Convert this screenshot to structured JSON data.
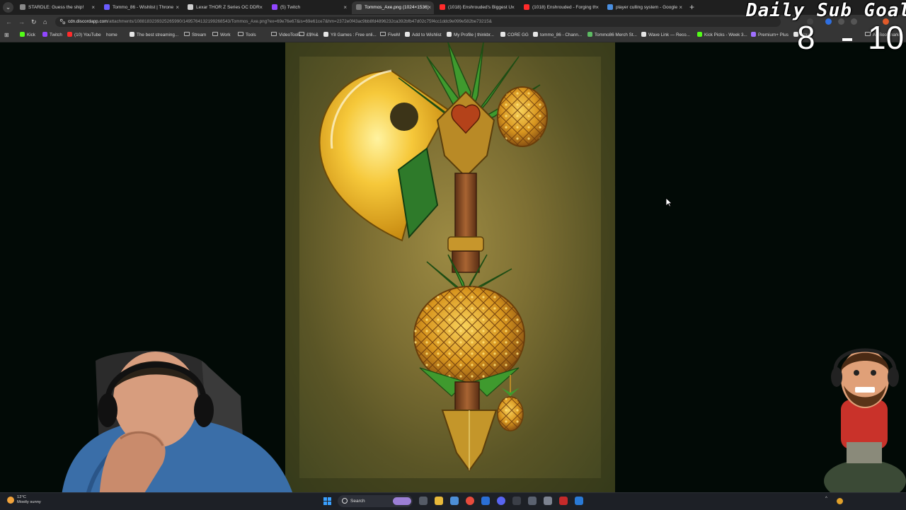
{
  "browser": {
    "tabs": [
      {
        "title": "STARDLE: Guess the ship!",
        "color": "#8a8a8a",
        "active": false
      },
      {
        "title": "Tommo_86 - Wishlist | Throne",
        "color": "#6b5cff",
        "active": false
      },
      {
        "title": "Lexar THOR Z Series OC DDR5",
        "color": "#cfcfcf",
        "active": false
      },
      {
        "title": "(5) Twitch",
        "color": "#9146ff",
        "active": false
      },
      {
        "title": "Tommos_Axe.png (1024×1536)",
        "color": "#7a7a7a",
        "active": true
      },
      {
        "title": "(1018) Enshrouded's Biggest U",
        "color": "#ff2b2b",
        "active": false
      },
      {
        "title": "(1018) Enshrouded - Forging th",
        "color": "#ff2b2b",
        "active": false
      },
      {
        "title": "player culling system - Google",
        "color": "#4a90e2",
        "active": false
      }
    ],
    "new_tab_label": "+",
    "url_host": "cdn.discordapp.com",
    "url_path": "/attachments/1088183239325265990/1495764132199268543/Tommos_Axe.png?ex=69e76e67&is=69e61ce7&hm=2372e0f43ac9bb8fd4896232ca392bfb47d02c75f4cc1ddc9e099e582be73215&",
    "bookmarks": [
      {
        "label": "Kick",
        "color": "#53fc18",
        "type": "icon"
      },
      {
        "label": "Twitch",
        "color": "#9146ff",
        "type": "icon"
      },
      {
        "label": "(10) YouTube",
        "color": "#ff2b2b",
        "type": "icon"
      },
      {
        "label": "home",
        "color": "",
        "type": "text"
      },
      {
        "label": "The best streaming...",
        "color": "#e6e6e6",
        "type": "icon"
      },
      {
        "label": "Stream",
        "color": "",
        "type": "folder"
      },
      {
        "label": "Work",
        "color": "",
        "type": "folder"
      },
      {
        "label": "Tools",
        "color": "",
        "type": "folder"
      },
      {
        "label": "VideoTools",
        "color": "",
        "type": "folder"
      },
      {
        "label": "£$%&",
        "color": "",
        "type": "folder"
      },
      {
        "label": "Y8 Games : Free onli...",
        "color": "#e6e6e6",
        "type": "icon"
      },
      {
        "label": "FiveM",
        "color": "",
        "type": "folder"
      },
      {
        "label": "Add to Wishlist",
        "color": "#e6e6e6",
        "type": "icon"
      },
      {
        "label": "My Profile | thinkbr...",
        "color": "#e6e6e6",
        "type": "icon"
      },
      {
        "label": "CORE GG",
        "color": "#e6e6e6",
        "type": "icon"
      },
      {
        "label": "tommo_86 - Chann...",
        "color": "#e6e6e6",
        "type": "icon"
      },
      {
        "label": "Tommo86 Merch St...",
        "color": "#5dbb63",
        "type": "icon"
      },
      {
        "label": "Wave Link — Reco...",
        "color": "#e6e6e6",
        "type": "icon"
      },
      {
        "label": "Kick Picks - Week 3...",
        "color": "#53fc18",
        "type": "icon"
      },
      {
        "label": "Premium+ Plus",
        "color": "#a070ff",
        "type": "icon"
      },
      {
        "label": "cloud",
        "color": "#e6e6e6",
        "type": "icon"
      }
    ],
    "all_bookmarks_label": "All Bookmarks"
  },
  "overlay": {
    "title": "Daily Sub Goal",
    "current": "8",
    "goal": "10"
  },
  "viewer": {
    "image_alt": "Tommos_Axe.png"
  },
  "taskbar": {
    "weather_temp": "12°C",
    "weather_desc": "Mostly sunny",
    "search_label": "Search"
  },
  "colors": {
    "tab_strip": "#1f1f1f",
    "toolbar": "#353535",
    "page_bg": "#020a06",
    "taskbar": "#1d2026"
  }
}
